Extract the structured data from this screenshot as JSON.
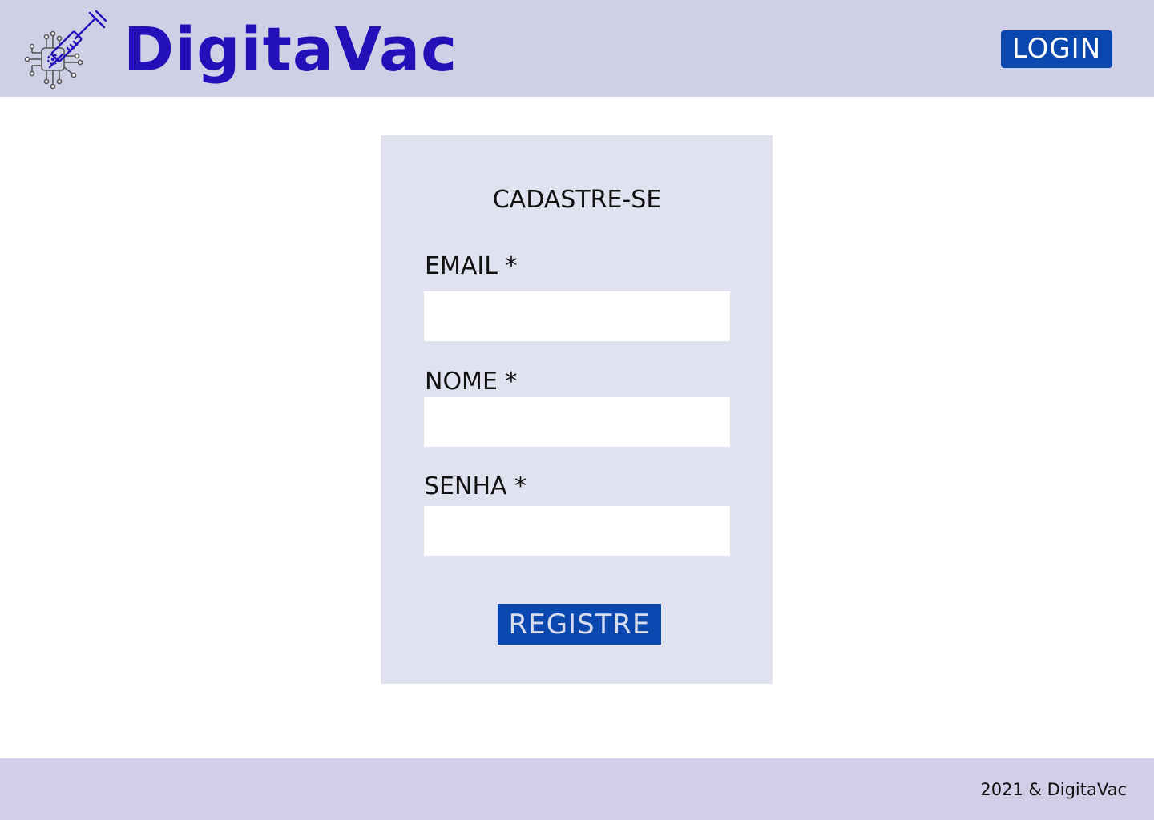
{
  "header": {
    "brand_name": "DigitaVac",
    "login_label": "LOGIN",
    "logo_icon": "syringe-chip-icon"
  },
  "form": {
    "title": "CADASTRE-SE",
    "email_label": "EMAIL *",
    "email_value": "",
    "name_label": "NOME *",
    "name_value": "",
    "password_label": "SENHA *",
    "password_value": "",
    "submit_label": "REGISTRE"
  },
  "footer": {
    "copyright": "2021 & DigitaVac"
  },
  "colors": {
    "header_bg": "#cfcfe6",
    "brand": "#2410b8",
    "button": "#0a48b0",
    "card_bg": "#e0e2ef",
    "footer_bg": "#d0cfe7"
  }
}
